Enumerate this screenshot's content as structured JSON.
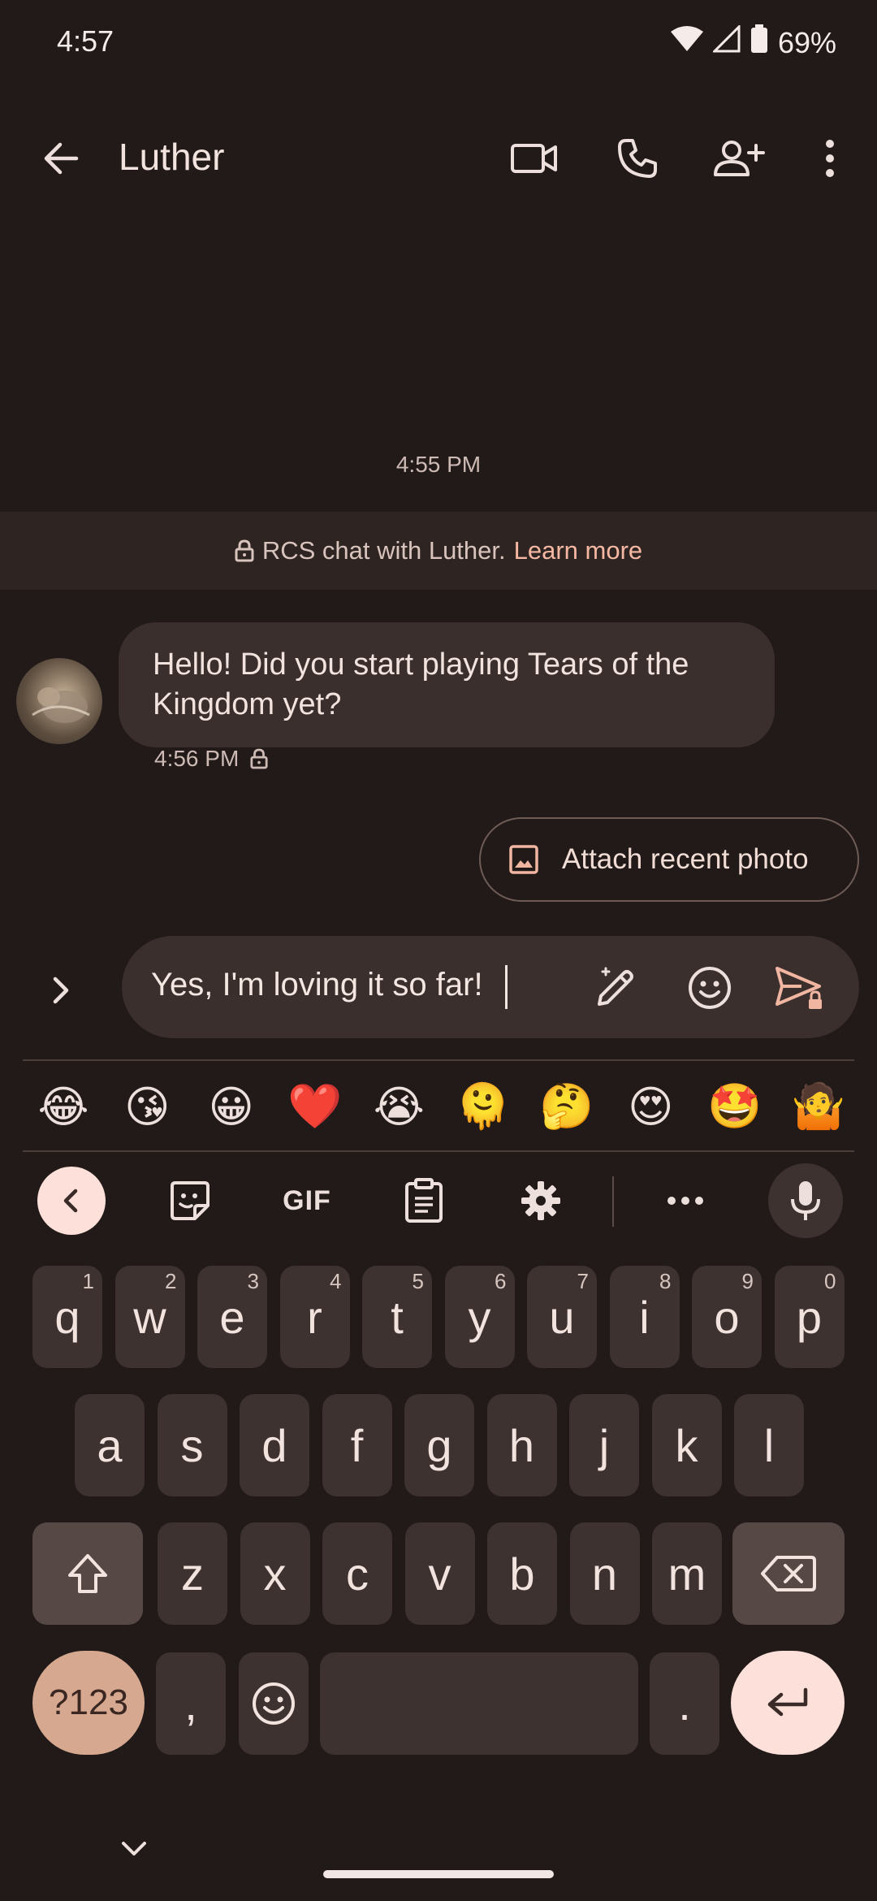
{
  "status_bar": {
    "time": "4:57",
    "battery": "69%"
  },
  "header": {
    "contact_name": "Luther",
    "actions": [
      "video-call",
      "voice-call",
      "add-person",
      "more-options"
    ]
  },
  "conversation": {
    "timestamp": "4:55 PM",
    "rcs_banner": {
      "text": "RCS chat with Luther.",
      "link": "Learn more"
    },
    "messages": [
      {
        "direction": "incoming",
        "text": "Hello! Did you start playing Tears of the Kingdom yet?",
        "time": "4:56 PM"
      }
    ],
    "suggestion_chip": "Attach recent photo"
  },
  "compose": {
    "text": "Yes, I'm loving it so far!"
  },
  "emoji_suggestions": [
    "😂",
    "😘",
    "😀",
    "❤️",
    "😭",
    "🫠",
    "🤔",
    "😍",
    "🤩",
    "🤷"
  ],
  "keyboard": {
    "toolbar": {
      "gif_label": "GIF"
    },
    "row1": [
      {
        "k": "q",
        "h": "1"
      },
      {
        "k": "w",
        "h": "2"
      },
      {
        "k": "e",
        "h": "3"
      },
      {
        "k": "r",
        "h": "4"
      },
      {
        "k": "t",
        "h": "5"
      },
      {
        "k": "y",
        "h": "6"
      },
      {
        "k": "u",
        "h": "7"
      },
      {
        "k": "i",
        "h": "8"
      },
      {
        "k": "o",
        "h": "9"
      },
      {
        "k": "p",
        "h": "0"
      }
    ],
    "row2": [
      "a",
      "s",
      "d",
      "f",
      "g",
      "h",
      "j",
      "k",
      "l"
    ],
    "row3": [
      "z",
      "x",
      "c",
      "v",
      "b",
      "n",
      "m"
    ],
    "symbols_label": "?123",
    "comma": ",",
    "period": "."
  },
  "colors": {
    "background": "#211a18",
    "bubble": "#3b2f2d",
    "accent_link": "#f6b8a2",
    "accent_button": "#fde0d9",
    "symbols_key": "#d7a890"
  }
}
